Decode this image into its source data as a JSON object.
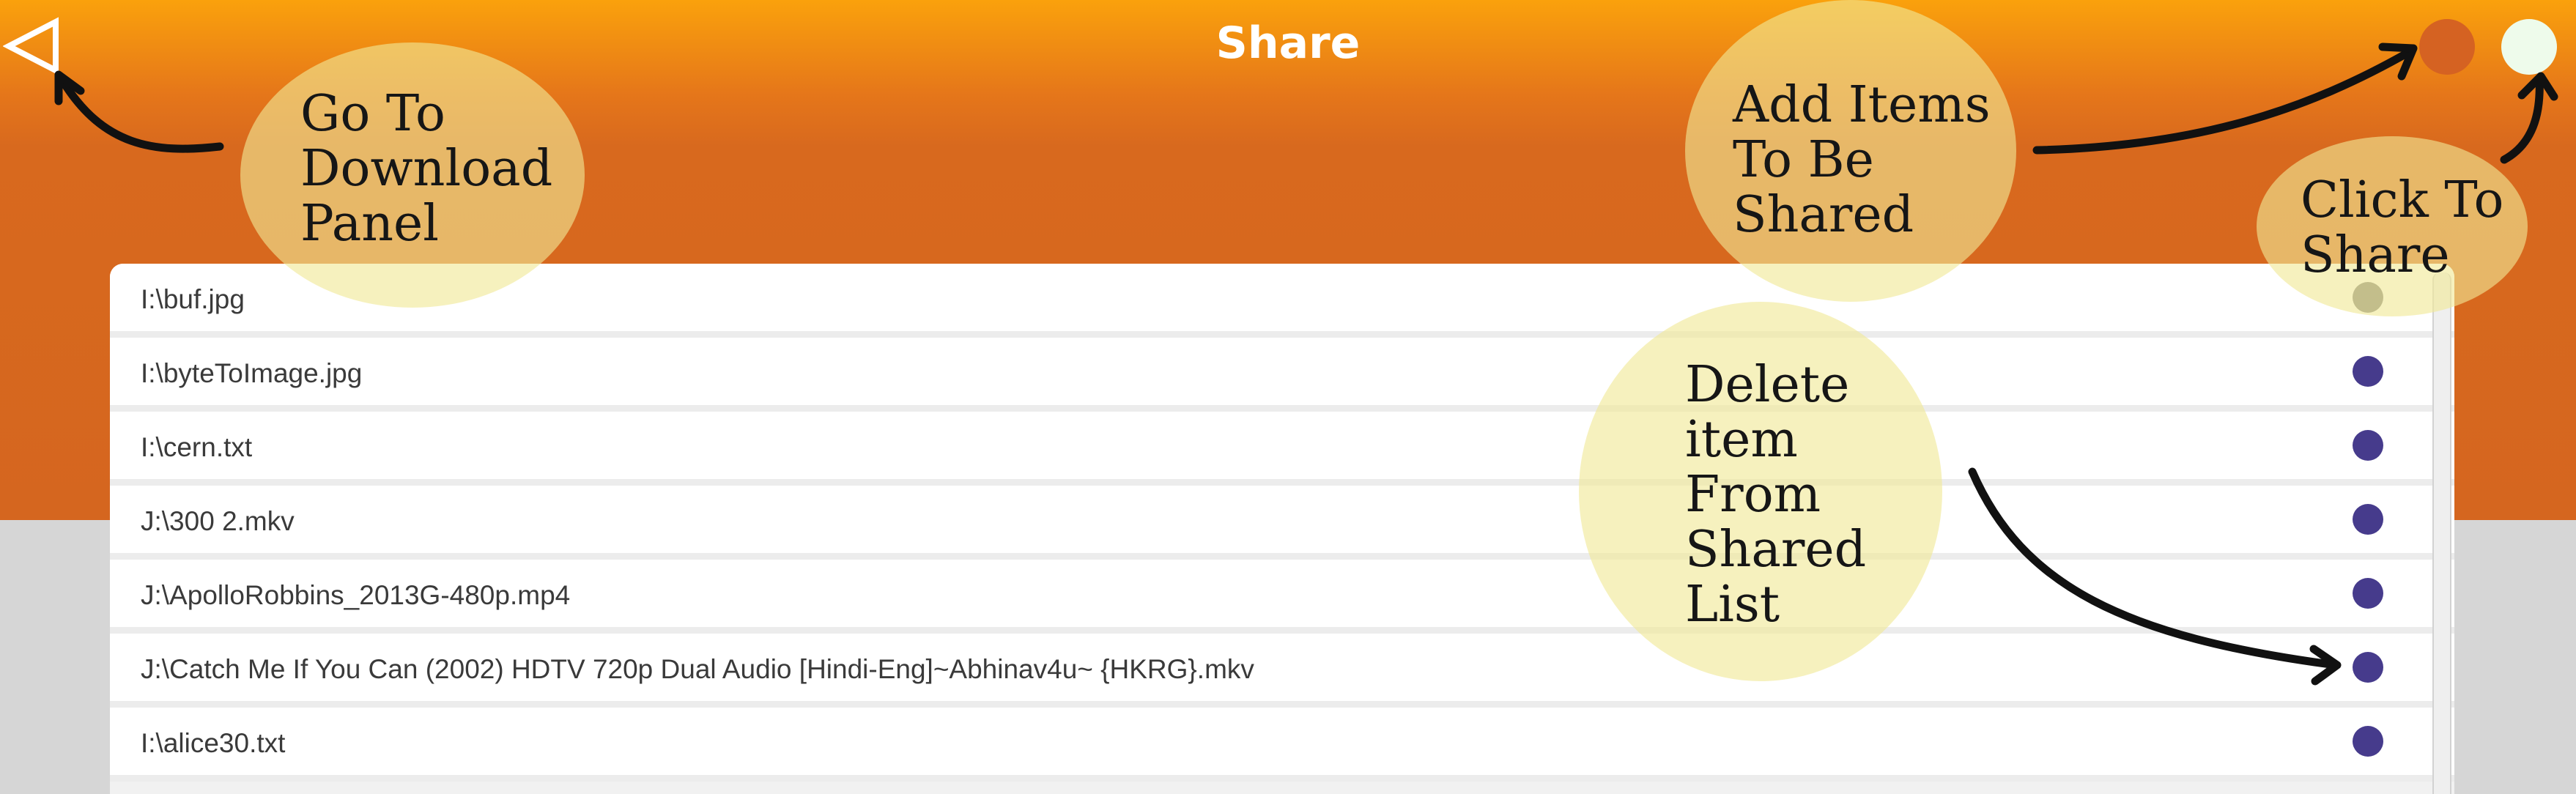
{
  "header": {
    "title": "Share",
    "colors": {
      "top": "#faa10c",
      "bottom": "#d5661f"
    }
  },
  "toolbar": {
    "back_icon": "back-triangle-icon",
    "add_icon": "add-items-icon",
    "share_icon": "share-icon"
  },
  "files": [
    {
      "path": "I:\\buf.jpg",
      "delete_color": "#7a7a7a"
    },
    {
      "path": "I:\\byteToImage.jpg",
      "delete_color": "#463b8c"
    },
    {
      "path": "I:\\cern.txt",
      "delete_color": "#463b8c"
    },
    {
      "path": "J:\\300 2.mkv",
      "delete_color": "#463b8c"
    },
    {
      "path": "J:\\ApolloRobbins_2013G-480p.mp4",
      "delete_color": "#463b8c"
    },
    {
      "path": "J:\\Catch Me If You Can (2002) HDTV 720p Dual Audio [Hindi-Eng]~Abhinav4u~ {HKRG}.mkv",
      "delete_color": "#463b8c"
    },
    {
      "path": "I:\\alice30.txt",
      "delete_color": "#463b8c"
    }
  ],
  "annotations": {
    "download_panel": "Go To\nDownload\nPanel",
    "add_items": "Add Items\nTo Be\nShared",
    "click_share": "Click To\nShare",
    "delete_item": "Delete\nitem\nFrom\nShared\nList"
  }
}
